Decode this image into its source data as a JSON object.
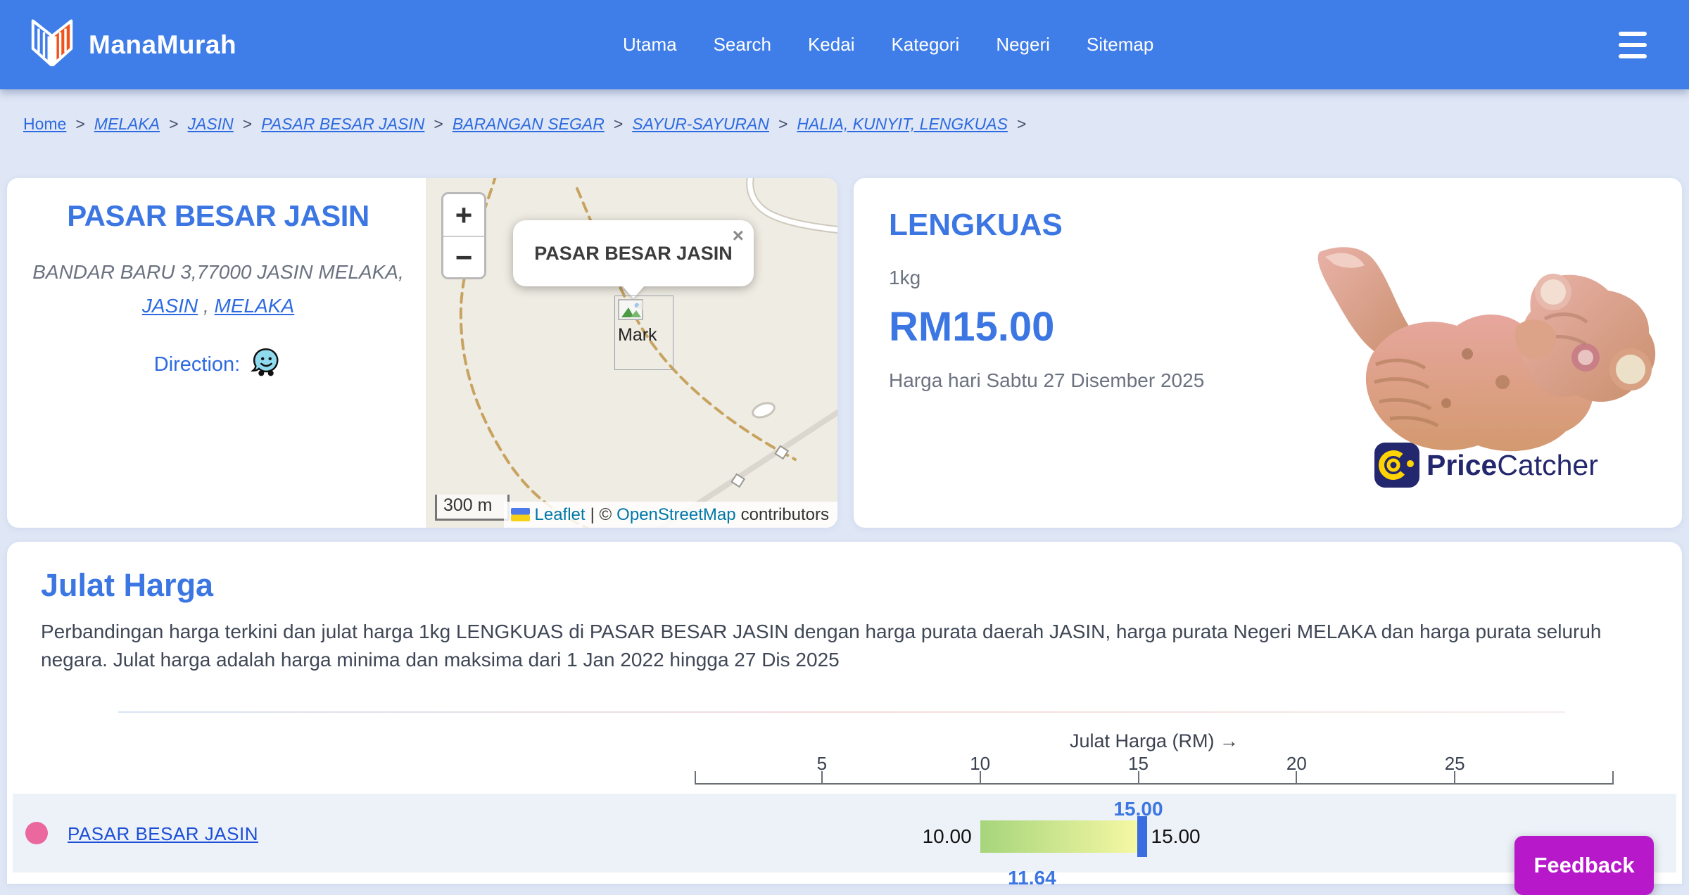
{
  "header": {
    "brand": "ManaMurah",
    "nav_items": [
      "Utama",
      "Search",
      "Kedai",
      "Kategori",
      "Negeri",
      "Sitemap"
    ]
  },
  "breadcrumb": {
    "separator": ">",
    "items": [
      {
        "label": "Home"
      },
      {
        "label": "MELAKA"
      },
      {
        "label": "JASIN"
      },
      {
        "label": "PASAR BESAR JASIN"
      },
      {
        "label": "BARANGAN SEGAR"
      },
      {
        "label": "SAYUR-SAYURAN"
      },
      {
        "label": "HALIA, KUNYIT, LENGKUAS"
      }
    ]
  },
  "market_card": {
    "title": "PASAR BESAR JASIN",
    "address_line": "BANDAR BARU 3,77000 JASIN MELAKA,",
    "district_link": "JASIN",
    "address_separator": " , ",
    "state_link": "MELAKA",
    "direction_label": "Direction:"
  },
  "map": {
    "zoom_in": "+",
    "zoom_out": "−",
    "popup_title": "PASAR BESAR JASIN",
    "popup_close": "×",
    "marker_alt": "Mark",
    "scale_label": "300 m",
    "attribution_leaflet": "Leaflet",
    "attribution_sep": "| ©",
    "attribution_osm": "OpenStreetMap",
    "attribution_suffix": "contributors"
  },
  "product_card": {
    "name": "LENGKUAS",
    "unit": "1kg",
    "price": "RM15.00",
    "price_date": "Harga hari Sabtu 27 Disember 2025",
    "logo_bold": "Price",
    "logo_regular": "Catcher"
  },
  "range_section": {
    "title": "Julat Harga",
    "description": "Perbandingan harga terkini dan julat harga 1kg LENGKUAS di PASAR BESAR JASIN dengan harga purata daerah JASIN, harga purata Negeri MELAKA dan harga purata seluruh negara. Julat harga adalah harga minima dan maksima dari 1 Jan 2022 hingga 27 Dis 2025"
  },
  "chart_data": {
    "type": "range-bar",
    "axis_label": "Julat Harga (RM) →",
    "axis_ticks": [
      5,
      10,
      15,
      20,
      25
    ],
    "axis_range": [
      1,
      30
    ],
    "rows": [
      {
        "label": "PASAR BESAR JASIN",
        "min": 10.0,
        "max": 15.0,
        "current": 15.0,
        "min_label": "10.00",
        "max_label": "15.00",
        "current_label": "15.00"
      },
      {
        "current": 11.64,
        "current_label": "11.64"
      }
    ]
  },
  "feedback": {
    "label": "Feedback"
  },
  "colors": {
    "header_bg": "#3f7de8",
    "page_bg": "#dfe7f6",
    "accent_blue": "#3b76e2",
    "link_blue": "#2d6ae0",
    "row_bg": "#edf2f9",
    "dot_pink": "#ea689d",
    "bar_gradient_start": "#a6d57b",
    "bar_gradient_end": "#f6f8a4",
    "marker_blue": "#3a6ee0",
    "feedback_magenta": "#b618ca"
  }
}
